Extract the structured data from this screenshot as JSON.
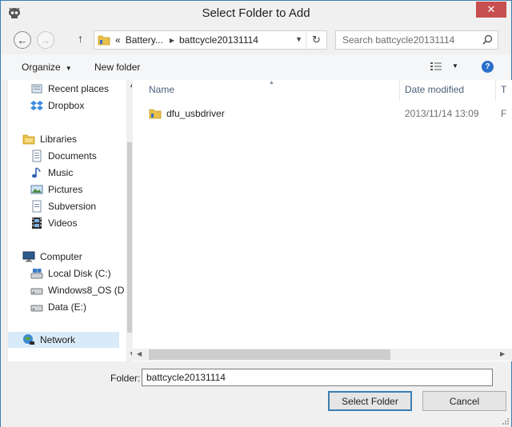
{
  "window": {
    "title": "Select Folder to Add",
    "close_label": "✕"
  },
  "address": {
    "segments": [
      "«",
      "Battery...",
      "battcycle20131114"
    ]
  },
  "search": {
    "placeholder": "Search battcycle20131114"
  },
  "toolbar": {
    "organize_label": "Organize",
    "new_folder_label": "New folder"
  },
  "nav": {
    "items": [
      {
        "label": "Recent places",
        "icon": "recent-places-icon"
      },
      {
        "label": "Dropbox",
        "icon": "dropbox-icon"
      },
      {
        "label": "Libraries",
        "icon": "libraries-icon"
      },
      {
        "label": "Documents",
        "icon": "documents-icon"
      },
      {
        "label": "Music",
        "icon": "music-icon"
      },
      {
        "label": "Pictures",
        "icon": "pictures-icon"
      },
      {
        "label": "Subversion",
        "icon": "subversion-icon"
      },
      {
        "label": "Videos",
        "icon": "videos-icon"
      },
      {
        "label": "Computer",
        "icon": "computer-icon"
      },
      {
        "label": "Local Disk (C:)",
        "icon": "local-disk-icon"
      },
      {
        "label": "Windows8_OS (D",
        "icon": "drive-icon"
      },
      {
        "label": "Data (E:)",
        "icon": "drive-icon"
      },
      {
        "label": "Network",
        "icon": "network-icon"
      }
    ]
  },
  "files": {
    "columns": {
      "name": "Name",
      "date": "Date modified",
      "type": "T"
    },
    "rows": [
      {
        "name": "dfu_usbdriver",
        "date": "2013/11/14 13:09",
        "type": "F"
      }
    ]
  },
  "bottom": {
    "folder_label": "Folder:",
    "folder_value": "battcycle20131114",
    "select_label": "Select Folder",
    "cancel_label": "Cancel"
  },
  "colors": {
    "accent": "#3c7fb1",
    "close": "#c74f50",
    "folder": "#e8c04a"
  }
}
